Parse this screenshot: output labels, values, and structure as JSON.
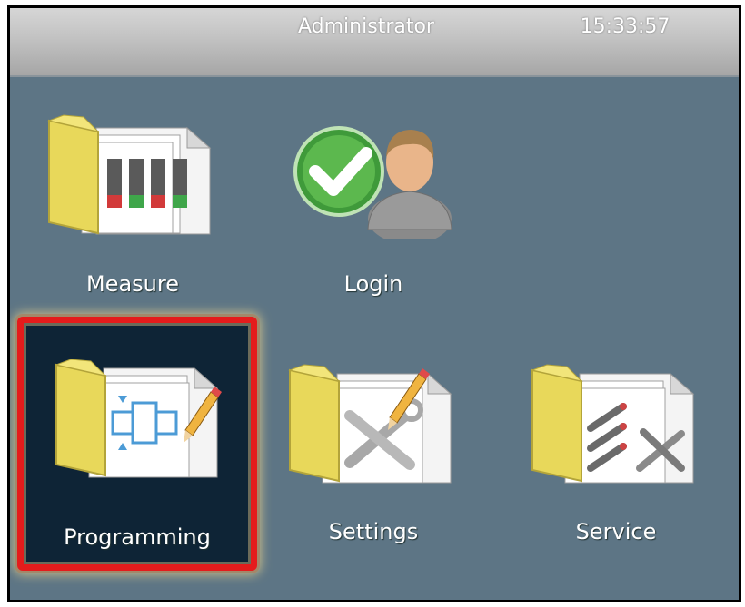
{
  "header": {
    "user": "Administrator",
    "time": "15:33:57"
  },
  "tiles": [
    {
      "label": "Measure",
      "icon": "folder-measure-icon"
    },
    {
      "label": "Login",
      "icon": "login-user-icon"
    },
    {
      "label": "Programming",
      "icon": "folder-programming-icon",
      "selected": true
    },
    {
      "label": "Settings",
      "icon": "folder-settings-icon"
    },
    {
      "label": "Service",
      "icon": "folder-service-icon"
    }
  ],
  "colors": {
    "background": "#5d7585",
    "selection_border": "#e41c1c",
    "selected_tile_bg": "#0e2436",
    "folder": "#e8d85a"
  }
}
